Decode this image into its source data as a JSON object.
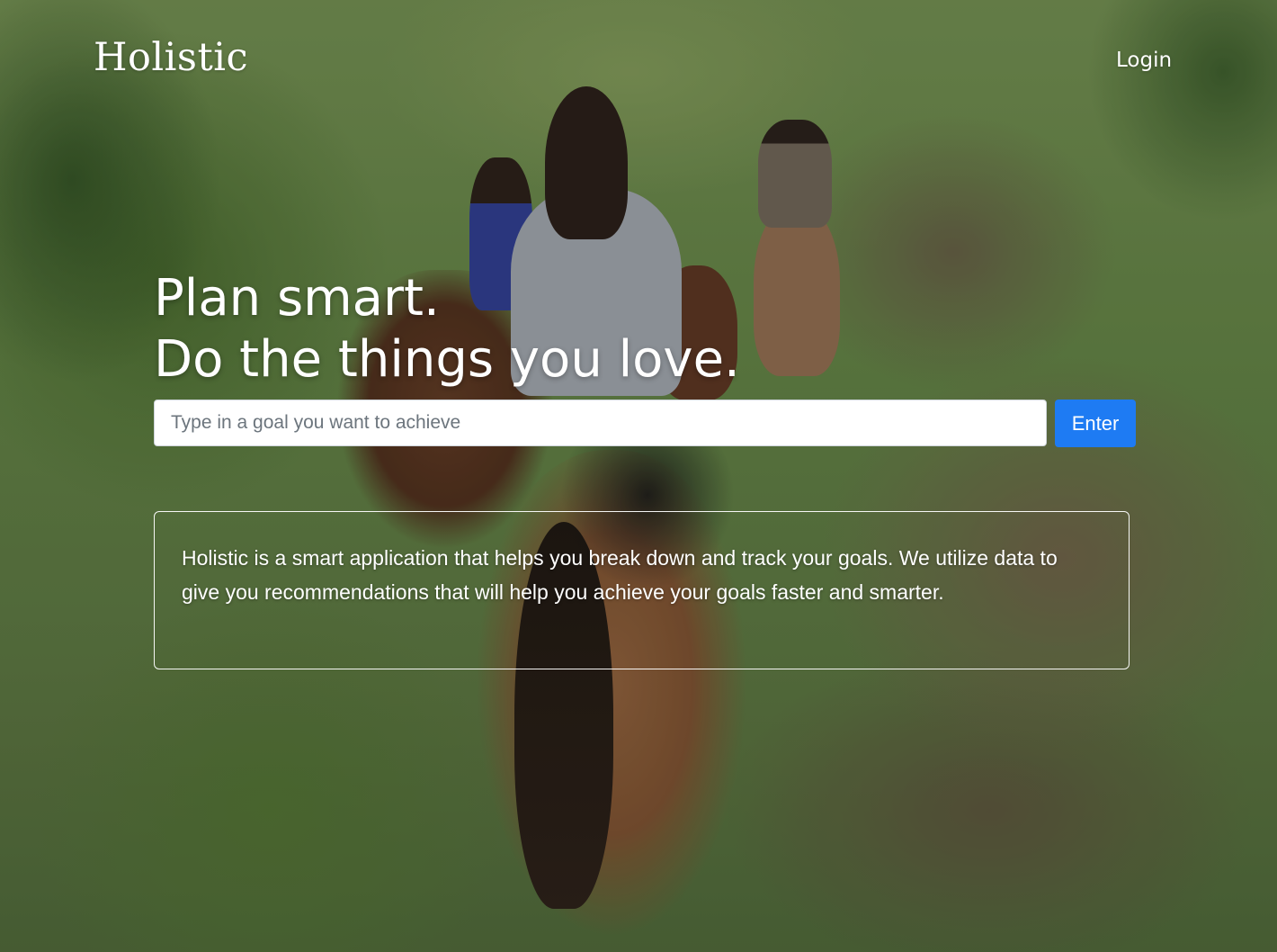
{
  "navbar": {
    "brand": "Holistic",
    "login_label": "Login"
  },
  "hero": {
    "headline_line1": "Plan smart.",
    "headline_line2": "Do the things you love.",
    "background_image": "horseback-riders-on-trail-photo"
  },
  "goal_form": {
    "input_value": "",
    "input_placeholder": "Type in a goal you want to achieve",
    "submit_label": "Enter"
  },
  "about": {
    "text": "Holistic is a smart application that helps you break down and track your goals. We utilize data to give you recommendations that will help you achieve your goals faster and smarter."
  },
  "colors": {
    "primary_button": "#1e7bf3",
    "text": "#ffffff",
    "input_background": "#ffffff"
  }
}
